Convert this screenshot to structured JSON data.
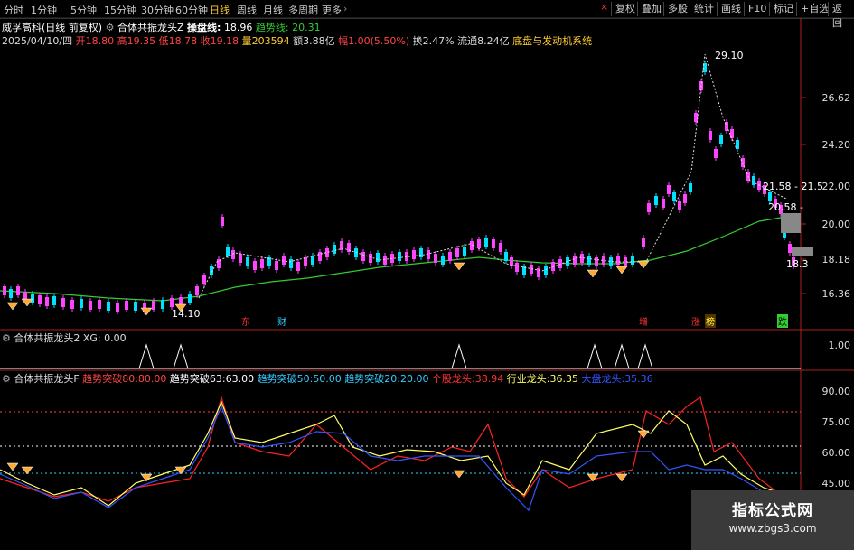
{
  "colors": {
    "up": "#ff44ff",
    "up_alt": "#ff3333",
    "down": "#00e0ff",
    "ma_green": "#33cc33",
    "yellow": "#ffff33",
    "blue": "#3366ff",
    "red": "#ff2222",
    "cyan": "#33ccff"
  },
  "toolbar": {
    "left_tabs": [
      "分时",
      "1分钟",
      "5分钟",
      "15分钟",
      "30分钟",
      "60分钟",
      "日线",
      "周线",
      "月线",
      "多周期",
      "更多"
    ],
    "active_tab": "日线",
    "right_buttons": [
      "复权",
      "叠加",
      "多股",
      "统计",
      "画线",
      "F10",
      "标记",
      "+自选",
      "返回"
    ],
    "close_symbol": "×"
  },
  "info": {
    "stock": "威孚高科(日线 前复权)",
    "indicator_name": "合体共振龙头Z",
    "pan_label": "操盘线:",
    "pan_value": "18.96",
    "trend_label": "趋势线:",
    "trend_value": "20.31",
    "date": "2025/04/10/四",
    "open_label": "开",
    "open": "18.80",
    "high_label": "高",
    "high": "19.35",
    "low_label": "低",
    "low": "18.78",
    "close_label": "收",
    "close": "19.18",
    "vol_label": "量",
    "volume": "203594",
    "amt_label": "额",
    "amount": "3.88亿",
    "amp_label": "幅",
    "amp": "1.00(5.50%)",
    "turnover": "换2.47%",
    "float": "流通8.24亿",
    "concept": "底盘与发动机系统"
  },
  "price_axis": [
    "26.62",
    "24.20",
    "22.00",
    "20.00",
    "18.18",
    "16.36"
  ],
  "annotations": {
    "high": "29.10",
    "low": "14.10",
    "right_top": "21.58 - 21.5",
    "right_mid": "20.58 -",
    "right_low": "18.3",
    "lower_right": "18.3"
  },
  "sub1": {
    "title": "合体共振龙头2",
    "xg": "XG: 0.00",
    "axis": [
      "1.00"
    ]
  },
  "sub2": {
    "title": "合体共振龙头F",
    "items": [
      {
        "label": "趋势突破80:",
        "value": "80.00"
      },
      {
        "label": "趋势突破63:",
        "value": "63.00"
      },
      {
        "label": "趋势突破50:",
        "value": "50.00"
      },
      {
        "label": "趋势突破20:",
        "value": "20.00"
      },
      {
        "label": "个股龙头:",
        "value": "38.94"
      },
      {
        "label": "行业龙头:",
        "value": "36.35"
      },
      {
        "label": "大盘龙头:",
        "value": "35.36"
      }
    ],
    "axis": [
      "90.00",
      "75.00",
      "60.00",
      "45.00"
    ]
  },
  "signals": {
    "s1": "东",
    "s2": "财",
    "s3": "增",
    "s4": "涨",
    "s5": "榜",
    "s6": "跌"
  },
  "watermark": {
    "line1": "指标公式网",
    "line2": "www.zbgs3.com"
  }
}
